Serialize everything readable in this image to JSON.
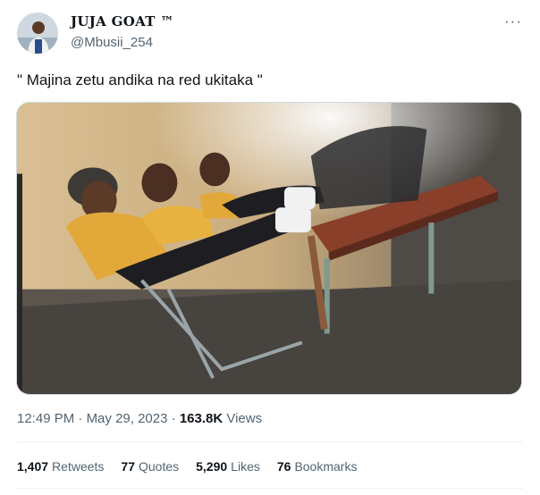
{
  "author": {
    "display_name": "JUJA GOAT ™",
    "handle": "@Mbusii_254",
    "avatar_icon": "profile-photo"
  },
  "menu": {
    "more_icon": "more-horizontal-icon",
    "more_glyph": "···"
  },
  "tweet": {
    "text": "\" Majina zetu andika na red ukitaka \""
  },
  "media": {
    "description_icon": "photo"
  },
  "meta": {
    "time": "12:49 PM",
    "separator": " · ",
    "date": "May 29, 2023",
    "views_count": "163.8K",
    "views_label": "Views"
  },
  "stats": {
    "retweets_count": "1,407",
    "retweets_label": "Retweets",
    "quotes_count": "77",
    "quotes_label": "Quotes",
    "likes_count": "5,290",
    "likes_label": "Likes",
    "bookmarks_count": "76",
    "bookmarks_label": "Bookmarks"
  },
  "colors": {
    "text_primary": "#0f1419",
    "text_secondary": "#536471",
    "divider": "#eff3f4",
    "media_border": "#cfd9de"
  }
}
